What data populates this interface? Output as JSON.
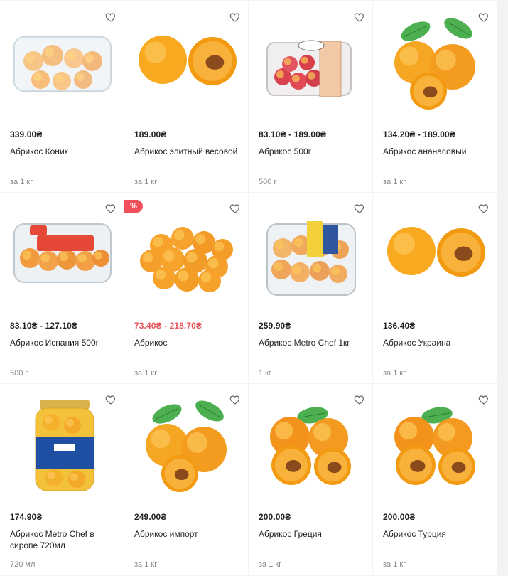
{
  "products": [
    {
      "price": "339.00₴",
      "name": "Абрикос Коник",
      "unit": "за 1 кг",
      "sale": false,
      "promo": false,
      "image": "apricots-in-plastic-container"
    },
    {
      "price": "189.00₴",
      "name": "Абрикос элитный весовой",
      "unit": "за 1 кг",
      "sale": false,
      "promo": false,
      "image": "apricot-whole-and-half"
    },
    {
      "price": "83.10₴ - 189.00₴",
      "name": "Абрикос 500г",
      "unit": "500 г",
      "sale": false,
      "promo": false,
      "image": "apricots-in-labeled-box"
    },
    {
      "price": "134.20₴ - 189.00₴",
      "name": "Абрикос ананасовый",
      "unit": "за 1 кг",
      "sale": false,
      "promo": false,
      "image": "apricots-with-leaves"
    },
    {
      "price": "83.10₴ - 127.10₴",
      "name": "Абрикос Испания 500г",
      "unit": "500 г",
      "sale": false,
      "promo": false,
      "image": "apricots-in-branded-tray"
    },
    {
      "price": "73.40₴ - 218.70₴",
      "name": "Абрикос",
      "unit": "за 1 кг",
      "sale": true,
      "promo": true,
      "image": "apricot-pile"
    },
    {
      "price": "259.90₴",
      "name": "Абрикос Metro Chef 1кг",
      "unit": "1 кг",
      "sale": false,
      "promo": false,
      "image": "apricots-in-clear-box"
    },
    {
      "price": "136.40₴",
      "name": "Абрикос Украина",
      "unit": "за 1 кг",
      "sale": false,
      "promo": false,
      "image": "apricot-whole-and-half"
    },
    {
      "price": "174.90₴",
      "name": "Абрикос Metro Chef в сиропе 720мл",
      "unit": "720 мл",
      "sale": false,
      "promo": false,
      "image": "apricots-in-syrup-jar"
    },
    {
      "price": "249.00₴",
      "name": "Абрикос импорт",
      "unit": "за 1 кг",
      "sale": false,
      "promo": false,
      "image": "apricots-with-leaves"
    },
    {
      "price": "200.00₴",
      "name": "Абрикос Греция",
      "unit": "за 1 кг",
      "sale": false,
      "promo": false,
      "image": "apricots-halved-with-leaf"
    },
    {
      "price": "200.00₴",
      "name": "Абрикос Турция",
      "unit": "за 1 кг",
      "sale": false,
      "promo": false,
      "image": "apricots-halved-with-leaf"
    }
  ],
  "promo_badge": "%",
  "colors": {
    "sale": "#e8525b",
    "promo": "#f0505a",
    "apricot": "#f5a623",
    "leaf": "#4caf50"
  }
}
